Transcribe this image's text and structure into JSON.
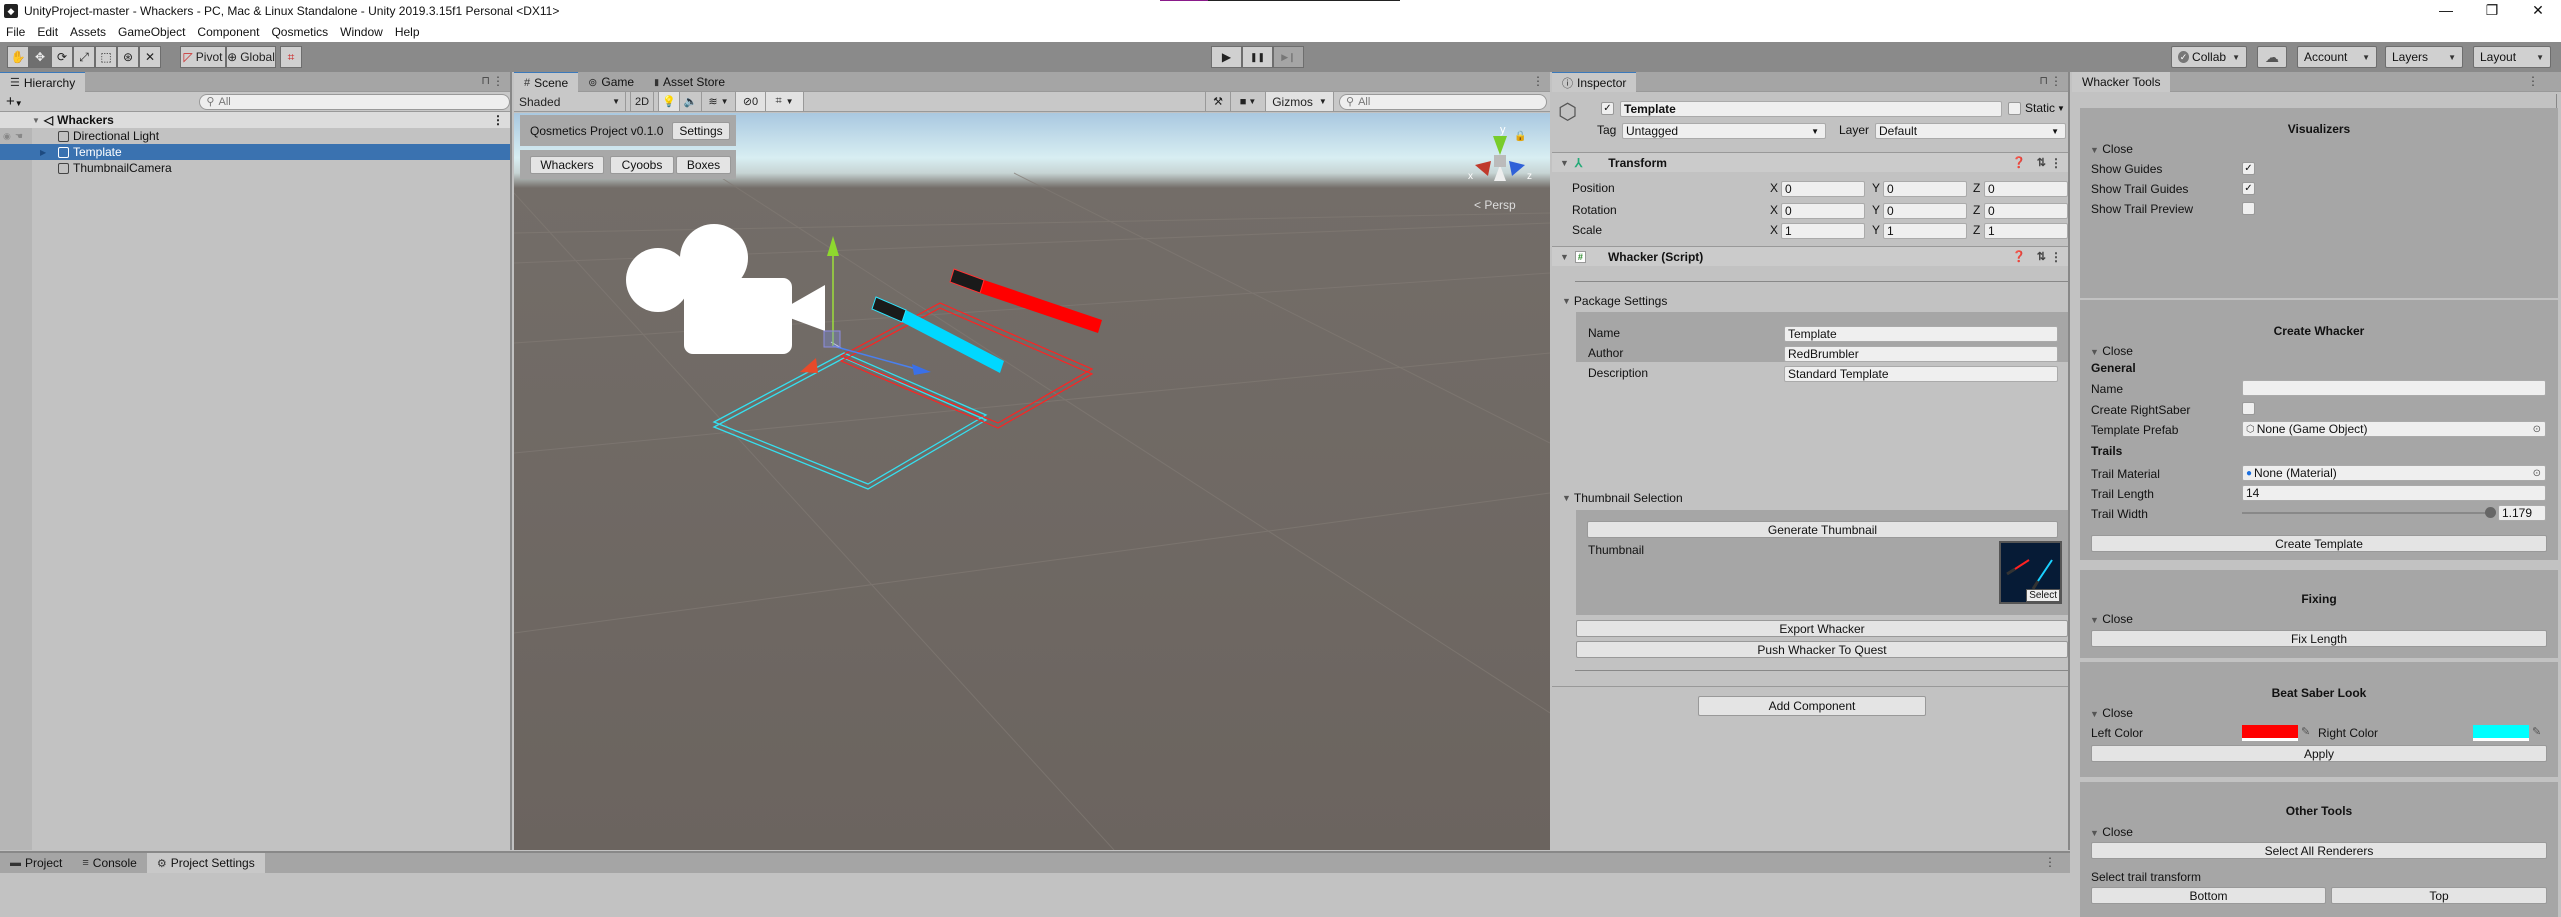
{
  "window": {
    "title": "UnityProject-master - Whackers - PC, Mac & Linux Standalone - Unity 2019.3.15f1 Personal <DX11>",
    "minimize": "—",
    "maximize": "❐",
    "close": "✕"
  },
  "menu": [
    "File",
    "Edit",
    "Assets",
    "GameObject",
    "Component",
    "Qosmetics",
    "Window",
    "Help"
  ],
  "toolbar": {
    "tools": [
      "hand-tool",
      "move-tool",
      "rotate-tool",
      "scale-tool",
      "rect-tool",
      "transform-tool",
      "custom-tool"
    ],
    "tool_glyphs": [
      "✋",
      "✥",
      "⟳",
      "⤢",
      "⬚",
      "⊛",
      "✕"
    ],
    "active_tool": "move-tool",
    "pivot_label": "Pivot",
    "global_label": "Global",
    "play": "▶",
    "pause": "❚❚",
    "step": "▶❙",
    "collab_label": "Collab",
    "account_label": "Account",
    "layers_label": "Layers",
    "layout_label": "Layout"
  },
  "hierarchy": {
    "tab_label": "Hierarchy",
    "search_placeholder": "All",
    "scene_name": "Whackers",
    "items": [
      {
        "label": "Directional Light",
        "selected": false,
        "expandable": false
      },
      {
        "label": "Template",
        "selected": true,
        "expandable": true
      },
      {
        "label": "ThumbnailCamera",
        "selected": false,
        "expandable": false
      }
    ]
  },
  "scene": {
    "tabs": [
      {
        "label": "Scene",
        "icon": "#",
        "active": true
      },
      {
        "label": "Game",
        "icon": "⊚",
        "active": false
      },
      {
        "label": "Asset Store",
        "icon": "🔒",
        "active": false
      }
    ],
    "shading_mode": "Shaded",
    "mode_2d": "2D",
    "hidden_count": "0",
    "gizmos_label": "Gizmos",
    "search_placeholder": "All",
    "projection_label": "Persp",
    "axis_labels": {
      "x": "x",
      "y": "y",
      "z": "z"
    },
    "overlay": {
      "project_title": "Qosmetics Project v0.1.0",
      "settings_button": "Settings",
      "category_buttons": [
        "Whackers",
        "Cyoobs",
        "Boxes"
      ]
    },
    "saber_colors": {
      "left": "#ff0000",
      "right": "#00d8ff"
    }
  },
  "inspector": {
    "tab_label": "Inspector",
    "object_name": "Template",
    "active": true,
    "static_label": "Static",
    "static": false,
    "tag_label": "Tag",
    "tag_value": "Untagged",
    "layer_label": "Layer",
    "layer_value": "Default",
    "transform": {
      "title": "Transform",
      "rows": [
        {
          "label": "Position",
          "x": "0",
          "y": "0",
          "z": "0"
        },
        {
          "label": "Rotation",
          "x": "0",
          "y": "0",
          "z": "0"
        },
        {
          "label": "Scale",
          "x": "1",
          "y": "1",
          "z": "1"
        }
      ]
    },
    "script": {
      "title": "Whacker (Script)",
      "package_settings_label": "Package Settings",
      "fields": [
        {
          "label": "Name",
          "value": "Template"
        },
        {
          "label": "Author",
          "value": "RedBrumbler"
        },
        {
          "label": "Description",
          "value": "Standard Template"
        }
      ],
      "thumbnail_selection_label": "Thumbnail Selection",
      "generate_thumbnail": "Generate Thumbnail",
      "thumbnail_label": "Thumbnail",
      "thumbnail_select": "Select",
      "export_button": "Export Whacker",
      "push_button": "Push Whacker To Quest"
    },
    "add_component": "Add Component"
  },
  "whacker_tools": {
    "tab_label": "Whacker Tools",
    "close_label": "Close",
    "visualizers": {
      "title": "Visualizers",
      "options": [
        {
          "label": "Show Guides",
          "checked": true
        },
        {
          "label": "Show Trail Guides",
          "checked": true
        },
        {
          "label": "Show Trail Preview",
          "checked": false
        }
      ]
    },
    "create": {
      "title": "Create Whacker",
      "general_label": "General",
      "name_label": "Name",
      "name_value": "",
      "right_saber_label": "Create RightSaber",
      "right_saber_checked": false,
      "template_prefab_label": "Template Prefab",
      "template_prefab_value": "None (Game Object)",
      "trails_label": "Trails",
      "trail_material_label": "Trail Material",
      "trail_material_value": "None (Material)",
      "trail_length_label": "Trail Length",
      "trail_length_value": "14",
      "trail_width_label": "Trail Width",
      "trail_width_value": "1.179",
      "trail_width_fraction": 0.99,
      "create_button": "Create Template"
    },
    "fixing": {
      "title": "Fixing",
      "fix_button": "Fix Length"
    },
    "beat_saber_look": {
      "title": "Beat Saber Look",
      "left_label": "Left Color",
      "left_color": "#ff0000",
      "right_label": "Right Color",
      "right_color": "#00ffff",
      "apply_button": "Apply"
    },
    "other": {
      "title": "Other Tools",
      "select_renderers": "Select All Renderers",
      "trail_transform_label": "Select trail transform",
      "bottom_button": "Bottom",
      "top_button": "Top"
    }
  },
  "bottom_tabs": [
    {
      "label": "Project",
      "icon": "▬",
      "active": false
    },
    {
      "label": "Console",
      "icon": "≡",
      "active": false
    },
    {
      "label": "Project Settings",
      "icon": "⚙",
      "active": true
    }
  ]
}
